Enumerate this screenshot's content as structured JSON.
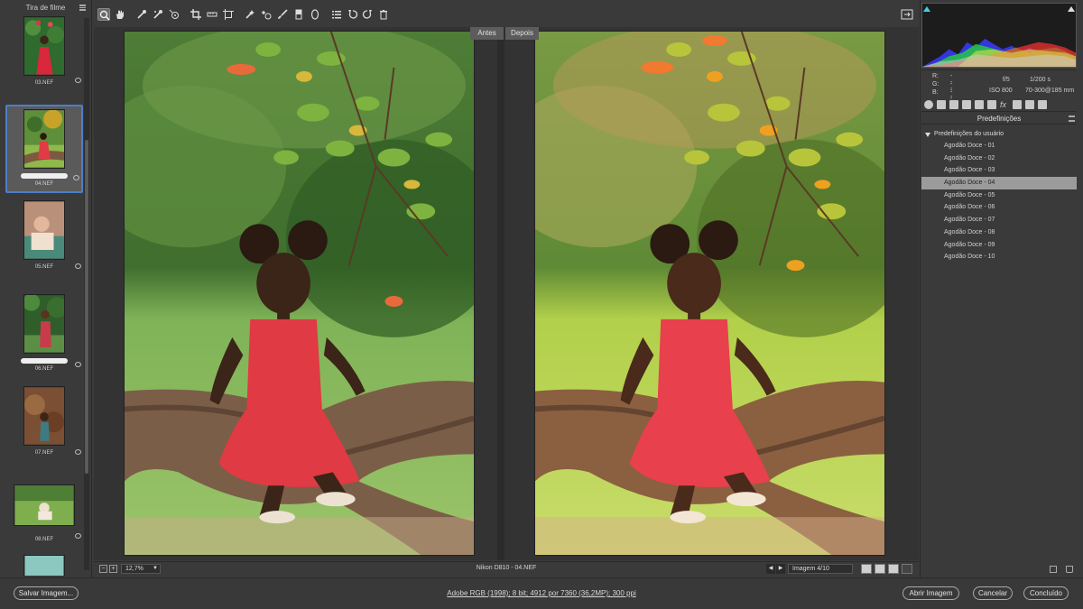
{
  "filmstrip": {
    "title": "Tira de filme",
    "items": [
      {
        "label": "03.NEF"
      },
      {
        "label": "04.NEF"
      },
      {
        "label": "05.NEF"
      },
      {
        "label": "06.NEF"
      },
      {
        "label": "07.NEF"
      },
      {
        "label": "08.NEF"
      }
    ]
  },
  "toolbar": {
    "tools": [
      "zoom-icon",
      "hand-icon",
      "white-balance-icon",
      "color-sampler-icon",
      "target-adjust-icon",
      "crop-icon",
      "straighten-icon",
      "transform-icon",
      "spot-removal-icon",
      "red-eye-icon",
      "adjustment-brush-icon",
      "graduated-filter-icon",
      "radial-filter-icon",
      "preferences-icon",
      "rotate-ccw-icon",
      "rotate-cw-icon",
      "trash-icon"
    ]
  },
  "compare": {
    "before_label": "Antes",
    "after_label": "Depois"
  },
  "canvas_footer": {
    "zoom": "12,7%",
    "file_info": "Nikon D810  -  04.NEF",
    "image_counter": "Imagem 4/10"
  },
  "info": {
    "r_label": "R:",
    "r_value": "---",
    "g_label": "G:",
    "g_value": "---",
    "b_label": "B:",
    "b_value": "---",
    "aperture": "f/5",
    "shutter": "1/200 s",
    "iso": "ISO 800",
    "lens": "70-300@185 mm"
  },
  "presets": {
    "panel_title": "Predefinições",
    "group_name": "Predefinições do usuário",
    "items": [
      "Agodão Doce - 01",
      "Agodão Doce - 02",
      "Agodão Doce - 03",
      "Agodão Doce - 04",
      "Agodão Doce - 05",
      "Agodão Doce - 06",
      "Agodão Doce - 07",
      "Agodão Doce - 08",
      "Agodão Doce - 09",
      "Agodão Doce - 10"
    ],
    "selected_index": 3
  },
  "bottom": {
    "save_label": "Salvar Imagem...",
    "workflow": "Adobe RGB (1998); 8 bit; 4912 por 7360 (36,2MP); 300 ppi",
    "open_label": "Abrir Imagem",
    "cancel_label": "Cancelar",
    "done_label": "Concluído"
  },
  "colors": {
    "selection_blue": "#4d7ec9",
    "dress_red": "#e43b45",
    "foliage_green": "#6fa83a"
  }
}
